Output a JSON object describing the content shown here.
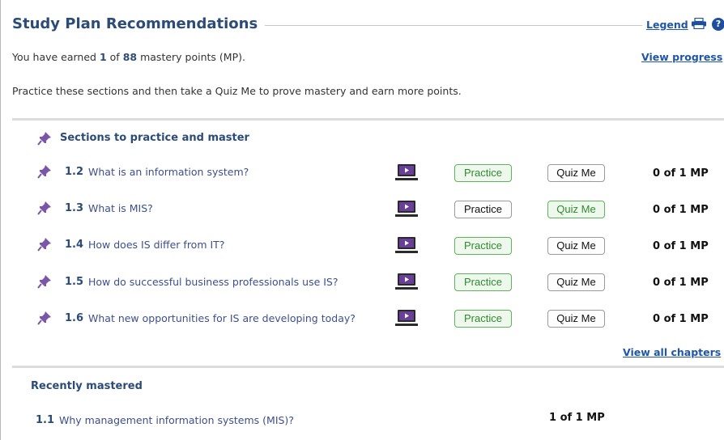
{
  "header": {
    "title": "Study Plan Recommendations",
    "legend_link": "Legend",
    "help_icon_glyph": "?"
  },
  "progress": {
    "earned_prefix": "You have earned",
    "earned_value": "1",
    "earned_of": "of",
    "total_value": "88",
    "earned_suffix": "mastery points (MP).",
    "view_progress_link": "View progress"
  },
  "instructions": "Practice these sections and then take a Quiz Me to prove mastery and earn more points.",
  "practice_section": {
    "heading": "Sections to practice and master",
    "rows": [
      {
        "number": "1.2",
        "title": "What is an information system?",
        "practice_label": "Practice",
        "quiz_label": "Quiz Me",
        "mp": "0 of 1 MP",
        "practice_highlight": true,
        "quiz_highlight": false
      },
      {
        "number": "1.3",
        "title": "What is MIS?",
        "practice_label": "Practice",
        "quiz_label": "Quiz Me",
        "mp": "0 of 1 MP",
        "practice_highlight": false,
        "quiz_highlight": true
      },
      {
        "number": "1.4",
        "title": "How does IS differ from IT?",
        "practice_label": "Practice",
        "quiz_label": "Quiz Me",
        "mp": "0 of 1 MP",
        "practice_highlight": true,
        "quiz_highlight": false
      },
      {
        "number": "1.5",
        "title": "How do successful business professionals use IS?",
        "practice_label": "Practice",
        "quiz_label": "Quiz Me",
        "mp": "0 of 1 MP",
        "practice_highlight": true,
        "quiz_highlight": false
      },
      {
        "number": "1.6",
        "title": "What new opportunities for IS are developing today?",
        "practice_label": "Practice",
        "quiz_label": "Quiz Me",
        "mp": "0 of 1 MP",
        "practice_highlight": true,
        "quiz_highlight": false
      }
    ],
    "view_all_link": "View all chapters"
  },
  "recently_mastered": {
    "heading": "Recently mastered",
    "rows": [
      {
        "number": "1.1",
        "title": "Why management information systems (MIS)?",
        "mp": "1 of 1 MP"
      }
    ]
  },
  "colors": {
    "title_blue": "#2b4b78",
    "link_blue": "#1f56a8",
    "pin_purple": "#7b55a8",
    "green_button": "#5cb55b"
  },
  "icons": {
    "pin": "pushpin-icon",
    "video": "video-monitor-icon",
    "print": "printer-icon",
    "help": "help-icon"
  }
}
